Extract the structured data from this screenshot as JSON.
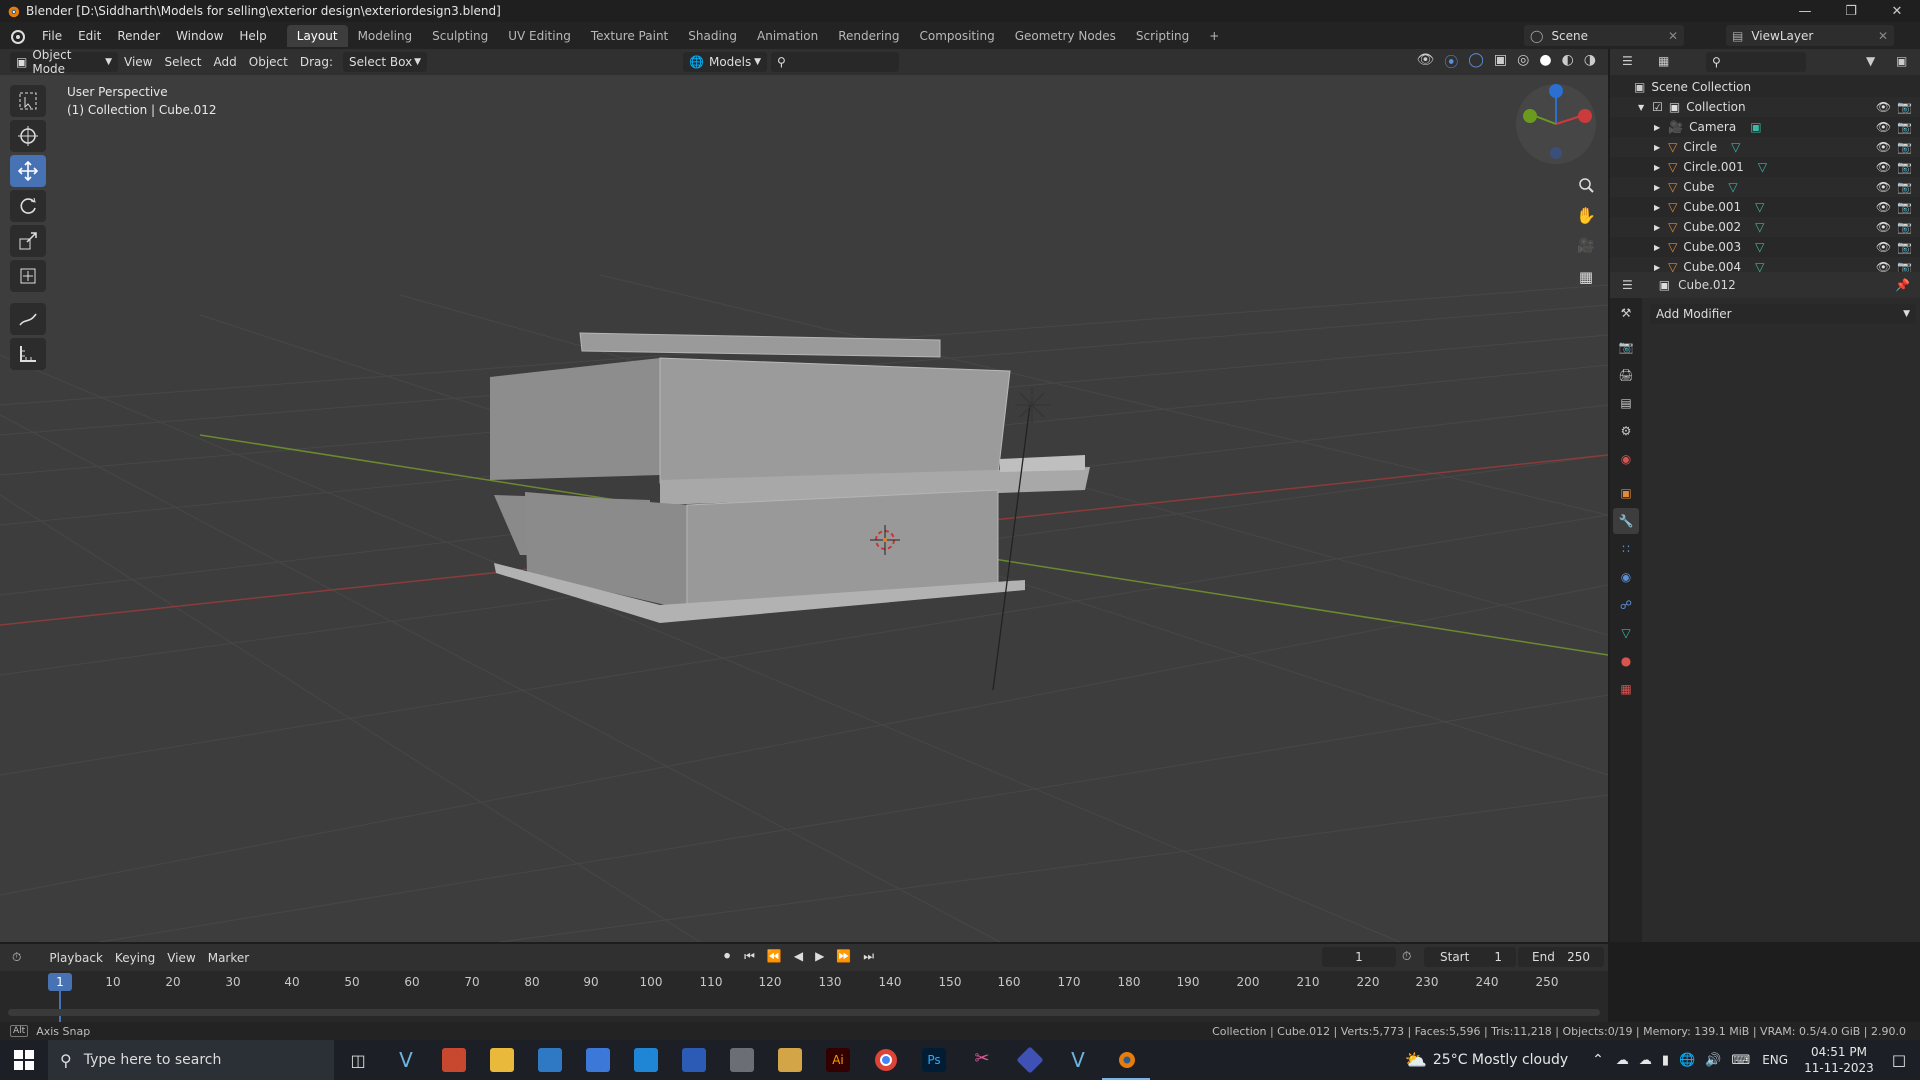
{
  "titlebar": {
    "title": "Blender [D:\\Siddharth\\Models for selling\\exterior design\\exteriordesign3.blend]"
  },
  "menubar": {
    "menus": [
      "File",
      "Edit",
      "Render",
      "Window",
      "Help"
    ],
    "workspaces": [
      "Layout",
      "Modeling",
      "Sculpting",
      "UV Editing",
      "Texture Paint",
      "Shading",
      "Animation",
      "Rendering",
      "Compositing",
      "Geometry Nodes",
      "Scripting",
      "+"
    ],
    "scene": "Scene",
    "view_layer": "ViewLayer"
  },
  "viewport_header": {
    "mode": "Object Mode",
    "view": "View",
    "select": "Select",
    "add": "Add",
    "object": "Object",
    "drag_label": "Drag:",
    "drag_value": "Select Box",
    "orientation": "Models"
  },
  "viewport": {
    "perspective": "User Perspective",
    "collection_info": "(1) Collection | Cube.012"
  },
  "outliner": {
    "root": "Scene Collection",
    "collection": "Collection",
    "items": [
      "Camera",
      "Circle",
      "Circle.001",
      "Cube",
      "Cube.001",
      "Cube.002",
      "Cube.003",
      "Cube.004"
    ]
  },
  "properties": {
    "object": "Cube.012",
    "add_modifier": "Add Modifier"
  },
  "timeline": {
    "menus": [
      "Playback",
      "Keying",
      "View",
      "Marker"
    ],
    "current_frame": "1",
    "start_label": "Start",
    "start_value": "1",
    "end_label": "End",
    "end_value": "250",
    "ticks": [
      "10",
      "20",
      "30",
      "40",
      "50",
      "60",
      "70",
      "80",
      "90",
      "100",
      "110",
      "120",
      "130",
      "140",
      "150",
      "160",
      "170",
      "180",
      "190",
      "200",
      "210",
      "220",
      "230",
      "240",
      "250"
    ],
    "playhead": "1"
  },
  "statusbar": {
    "left": "Axis Snap",
    "right": "Collection | Cube.012 | Verts:5,773 | Faces:5,596 | Tris:11,218 | Objects:0/19 | Memory: 139.1 MiB | VRAM: 0.5/4.0 GiB | 2.90.0"
  },
  "taskbar": {
    "search_placeholder": "Type here to search",
    "weather": "25°C  Mostly cloudy",
    "lang": "ENG",
    "time": "04:51 PM",
    "date": "11-11-2023"
  }
}
